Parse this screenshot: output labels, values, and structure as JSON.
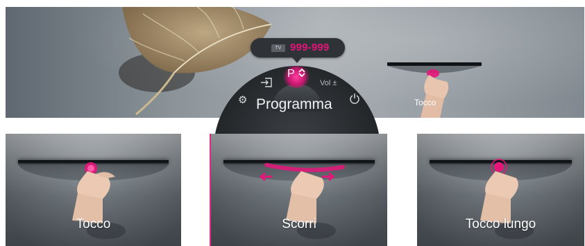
{
  "banner": {
    "tv_icon_label": "TV",
    "channel_number": "999-999",
    "program_up_down": "P",
    "volume_label": "Vol ±",
    "dial_title": "Programma",
    "mini_caption": "Tocco",
    "icons": [
      "input-icon",
      "gear-icon",
      "power-icon",
      "chevron-up-down-icon"
    ]
  },
  "gestures": [
    {
      "caption": "Tocco"
    },
    {
      "caption": "Scorri"
    },
    {
      "caption": "Tocco lungo"
    }
  ],
  "colors": {
    "accent": "#e5157a",
    "dial_background": "#25282b",
    "panel_text": "#ffffff"
  }
}
